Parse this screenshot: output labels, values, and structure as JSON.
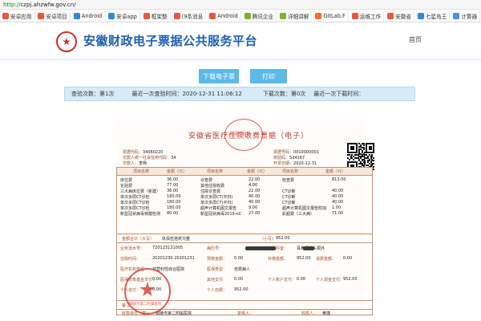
{
  "browser": {
    "url_scheme": "http://",
    "url_host": "czpj.ahzwfw.gov.cn/",
    "bookmarks": [
      {
        "label": "安卓应用",
        "color": "#e9573f"
      },
      {
        "label": "安卓项目",
        "color": "#e9573f"
      },
      {
        "label": "Android",
        "color": "#2b8bd8"
      },
      {
        "label": "安卓app",
        "color": "#2b8bd8"
      },
      {
        "label": "框架整",
        "color": "#e9573f"
      },
      {
        "label": "(9条消息",
        "color": "#e9573f"
      },
      {
        "label": "Android",
        "color": "#e9573f"
      },
      {
        "label": "腾讯企业",
        "color": "#7bb32e"
      },
      {
        "label": "详细讲解",
        "color": "#7bb32e"
      },
      {
        "label": "GitLab.F",
        "color": "#fc6d26"
      },
      {
        "label": "运维工作",
        "color": "#e9573f"
      },
      {
        "label": "安徽省",
        "color": "#e9573f"
      },
      {
        "label": "七星岛王",
        "color": "#2b8bd8"
      },
      {
        "label": "计算器",
        "color": "#4a90d9"
      }
    ]
  },
  "header": {
    "title": "安徽财政电子票据公共服务平台",
    "nav_home": "首页"
  },
  "actions": {
    "download_label": "下载电子票",
    "print_label": "打印"
  },
  "status": {
    "verify_count": "查验次数：第1次",
    "last_verify": "最近一次查验时间：2020-12-31 11:06:12",
    "download_count": "下载次数：第0次",
    "last_download": "最近一次下载时间："
  },
  "invoice": {
    "title": "安徽省医疗住院收费票据（电子）",
    "stamp_top": "财政部监制",
    "meta_left": [
      {
        "label": "票据代码：",
        "value": "34060220"
      },
      {
        "label": "交款人统一社会信用代码：",
        "value": "34"
      },
      {
        "label": "交款人：",
        "value": "李杨"
      }
    ],
    "meta_right": [
      {
        "label": "票据号码：",
        "value": "0010000001"
      },
      {
        "label": "校验码：",
        "value": "5d4167"
      },
      {
        "label": "开票日期：",
        "value": "2020-12-31"
      }
    ],
    "headers": [
      "项目名称",
      "金额（元）",
      "项目名称",
      "金额（元）",
      "项目名称",
      "金额（元）"
    ],
    "col1": [
      [
        "床位费",
        "36.00"
      ],
      [
        "化验费",
        "77.00"
      ],
      [
        "三大病床位费（新建）",
        "36.00"
      ],
      [
        "单次多层CT诊检",
        "180.00"
      ],
      [
        "单次多层CT诊检",
        "180.00"
      ],
      [
        "单次多层CT诊检",
        "180.00"
      ],
      [
        "新型冠状病毒核酸检测",
        "80.00"
      ]
    ],
    "col2": [
      [
        "诊查费",
        "22.00"
      ],
      [
        "其他住院收费",
        "4.00"
      ],
      [
        "住院诊查费",
        "22.00"
      ],
      [
        "单次多层CT(平扫)",
        "40.00"
      ],
      [
        "单次多层CT(平扫)",
        "40.00"
      ],
      [
        "超声计算机图文报告",
        "9.00"
      ],
      [
        "新型冠状病毒2019-nC",
        "27.00"
      ]
    ],
    "col3": [
      [
        "检查费",
        "813.00"
      ],
      [
        "",
        ""
      ],
      [
        "CT诊断",
        "40.00"
      ],
      [
        "CT诊断",
        "40.00"
      ],
      [
        "CT诊断",
        "40.00"
      ],
      [
        "超声计算机图文报告附加",
        "1.00"
      ],
      [
        "彩超费（三大病）",
        "71.00"
      ]
    ],
    "total_label": "金额合计（大写）",
    "total_upper": "玖佰伍拾贰元整",
    "total_small_label": "（小写）",
    "total_small": "952.00",
    "info_rows": [
      [
        [
          "业务流水号：",
          "720123131005"
        ],
        [
          "病历号：",
          ""
        ],
        [
          "住院科室：",
          "耳鼻咽喉头颈外"
        ]
      ],
      [
        [
          "住院时间：",
          "20201230-20201231"
        ],
        [
          "预缴金额：",
          "0.00"
        ],
        [
          "补缴金额：",
          "952.00"
        ],
        [
          "退费金额：",
          "0.00"
        ]
      ],
      [
        [
          "医疗机构类型：",
          "非营利性综合医院"
        ],
        [
          "医保类型：",
          "自费病人"
        ],
        [
          "",
          ""
        ]
      ],
      [
        [
          "医保统筹基金支付：",
          "0.00"
        ],
        [
          "其他支付：",
          "0.00"
        ],
        [
          "个人账户支付：",
          "0.00"
        ],
        [
          "个人现金支付：",
          "952.00"
        ]
      ],
      [
        [
          "个人自付：",
          "0.00"
        ],
        [
          "个人自费：",
          "952.00"
        ],
        [
          "",
          ""
        ]
      ]
    ],
    "remark_label": "备注",
    "payee_label": "收款单位（章）：",
    "payee": "铜陵市第二附属医院",
    "reviewer_label": "复核人：",
    "collector_label": "收款人：",
    "collector": "黄捷",
    "stamp_bottom": "铜陵市第二附属医院"
  }
}
